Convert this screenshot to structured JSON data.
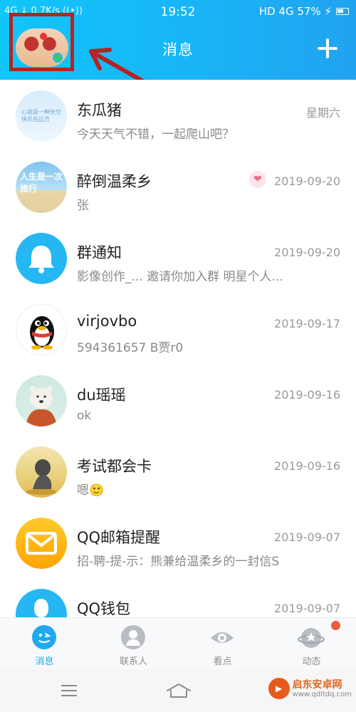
{
  "status_bar": {
    "left": "4G ↓ 0.7K/s ((•))",
    "time": "19:52",
    "right": "HD 4G 57% ⚡"
  },
  "header": {
    "title": "消息"
  },
  "messages": [
    {
      "name": "东瓜猪",
      "preview": "今天天气不错，一起爬山吧？",
      "time": "星期六",
      "avatar_text": "心就是一种天空\n快乐在远方"
    },
    {
      "name": "醉倒温柔乡",
      "preview": "张",
      "time": "2019-09-20",
      "avatar_text": "人生是一次旅行"
    },
    {
      "name": "群通知",
      "preview": "影像创作_... 邀请你加入群 明星个人...",
      "time": "2019-09-20"
    },
    {
      "name": "virjovbo",
      "preview": "594361657  B贾r0",
      "time": "2019-09-17"
    },
    {
      "name": "du瑶瑶",
      "preview": "ok",
      "time": "2019-09-16"
    },
    {
      "name": "考试都会卡",
      "preview": "嗯🙂",
      "time": "2019-09-16"
    },
    {
      "name": "QQ邮箱提醒",
      "preview": "招-聘-提-示：熊兼给温柔乡的一封信S",
      "time": "2019-09-07"
    },
    {
      "name": "QQ钱包",
      "preview": "",
      "time": "2019-09-07"
    }
  ],
  "tabs": [
    {
      "label": "消息"
    },
    {
      "label": "联系人"
    },
    {
      "label": "看点"
    },
    {
      "label": "动态"
    }
  ],
  "watermark": {
    "name": "启东安卓网",
    "url": "www.qdltdq.com"
  },
  "colors": {
    "accent": "#1faaf0",
    "header": "#19b4f6",
    "highlight": "#b32424",
    "online": "#2ecc71"
  }
}
